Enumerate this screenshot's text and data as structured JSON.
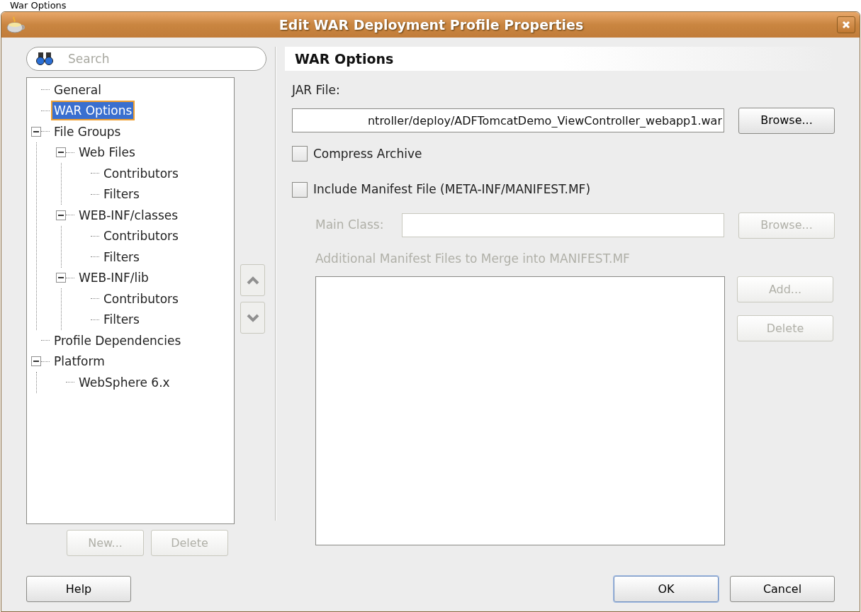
{
  "page_heading": "War Options",
  "window": {
    "title": "Edit WAR Deployment Profile Properties"
  },
  "search": {
    "placeholder": "Search"
  },
  "tree": [
    {
      "label": "General",
      "selected": false
    },
    {
      "label": "WAR Options",
      "selected": true
    },
    {
      "label": "File Groups",
      "selected": false,
      "expanded": true,
      "children": [
        {
          "label": "Web Files",
          "selected": false,
          "expanded": true,
          "children": [
            {
              "label": "Contributors",
              "selected": false
            },
            {
              "label": "Filters",
              "selected": false
            }
          ]
        },
        {
          "label": "WEB-INF/classes",
          "selected": false,
          "expanded": true,
          "children": [
            {
              "label": "Contributors",
              "selected": false
            },
            {
              "label": "Filters",
              "selected": false
            }
          ]
        },
        {
          "label": "WEB-INF/lib",
          "selected": false,
          "expanded": true,
          "children": [
            {
              "label": "Contributors",
              "selected": false
            },
            {
              "label": "Filters",
              "selected": false
            }
          ]
        }
      ]
    },
    {
      "label": "Profile Dependencies",
      "selected": false
    },
    {
      "label": "Platform",
      "selected": false,
      "expanded": true,
      "children": [
        {
          "label": "WebSphere 6.x",
          "selected": false
        }
      ]
    }
  ],
  "tree_buttons": [
    {
      "label": "New...",
      "disabled": true
    },
    {
      "label": "Delete",
      "disabled": true
    }
  ],
  "section_title": "WAR Options",
  "jar_file": {
    "label": "JAR File:",
    "value": "ntroller/deploy/ADFTomcatDemo_ViewController_webapp1.war",
    "browse_label": "Browse..."
  },
  "checkboxes": [
    {
      "label": "Compress Archive",
      "checked": false
    },
    {
      "label": "Include Manifest File (META-INF/MANIFEST.MF)",
      "checked": false
    }
  ],
  "main_class": {
    "label": "Main Class:",
    "disabled": true,
    "browse_label": "Browse..."
  },
  "manifest_files": {
    "label": "Additional Manifest Files to Merge into MANIFEST.MF",
    "disabled": true,
    "buttons": [
      {
        "label": "Add..."
      },
      {
        "label": "Delete"
      }
    ]
  },
  "footer_buttons": [
    {
      "label": "Help",
      "default": false
    },
    {
      "label": "OK",
      "default": true
    },
    {
      "label": "Cancel",
      "default": false
    }
  ]
}
